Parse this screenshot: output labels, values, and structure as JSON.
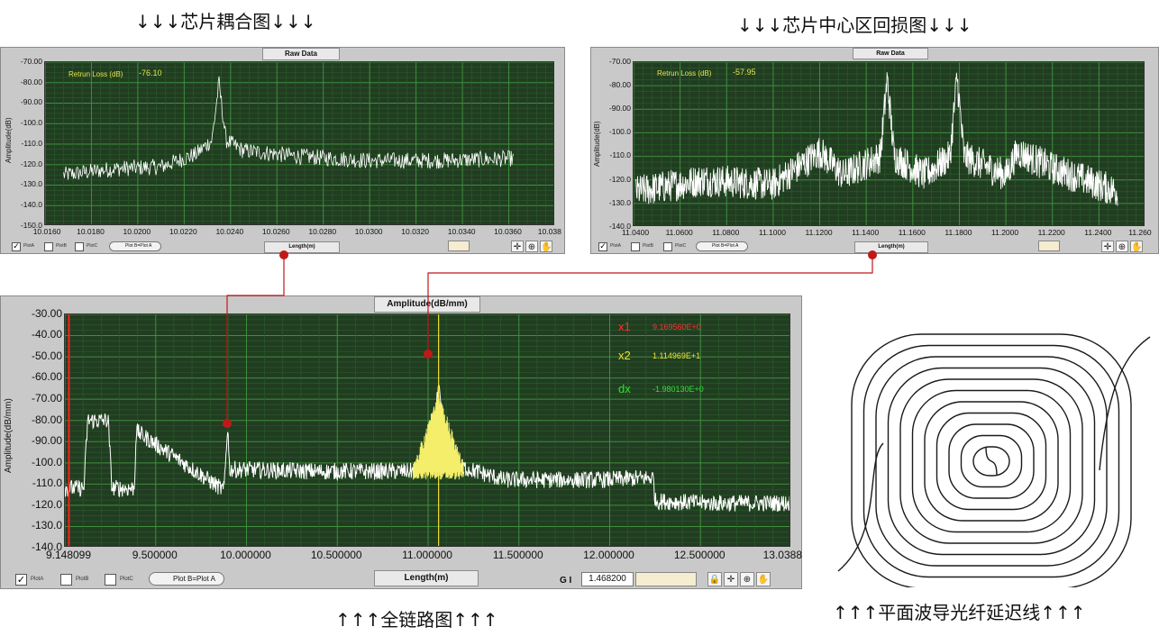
{
  "captions": {
    "chip_coupling": "↓↓↓芯片耦合图↓↓↓",
    "chip_center": "↓↓↓芯片中心区回损图↓↓↓",
    "full_link": "↑↑↑全链路图↑↑↑",
    "waveguide": "↑↑↑平面波导光纤延迟线↑↑↑"
  },
  "panels": {
    "p1": {
      "tab_top": "Raw Data",
      "tab_bottom": "Length(m)",
      "ylabel": "Amplitude(dB)",
      "annotation_label": "Retrun Loss  (dB)",
      "annotation_value": "-76.10",
      "checkboxes": [
        "PlotA",
        "PlotB",
        "PlotC"
      ],
      "plot_button": "Plot B=Plot A",
      "yticks": [
        "-70.00",
        "-80.00",
        "-90.00",
        "-100.0",
        "-110.0",
        "-120.0",
        "-130.0",
        "-140.0",
        "-150.0"
      ],
      "xticks": [
        "10.0160",
        "10.0180",
        "10.0200",
        "10.0220",
        "10.0240",
        "10.0260",
        "10.0280",
        "10.0300",
        "10.0320",
        "10.0340",
        "10.0360",
        "10.038"
      ]
    },
    "p2": {
      "tab_top": "Raw Data",
      "tab_bottom": "Length(m)",
      "ylabel": "Amplitude(dB)",
      "annotation_label": "Retrun Loss  (dB)",
      "annotation_value": "-57.95",
      "checkboxes": [
        "PlotA",
        "PlotB",
        "PlotC"
      ],
      "plot_button": "Plot B=Plot A",
      "yticks": [
        "-70.00",
        "-80.00",
        "-90.00",
        "-100.0",
        "-110.0",
        "-120.0",
        "-130.0",
        "-140.0"
      ],
      "xticks": [
        "11.0400",
        "11.0600",
        "11.0800",
        "11.1000",
        "11.1200",
        "11.1400",
        "11.1600",
        "11.1800",
        "11.2000",
        "11.2200",
        "11.2400",
        "11.260"
      ]
    },
    "p3": {
      "tab_top": "Amplitude(dB/mm)",
      "tab_bottom": "Length(m)",
      "ylabel": "Amplitude(dB/mm)",
      "checkboxes": [
        "PlotA",
        "PlotB",
        "PlotC"
      ],
      "plot_button": "Plot B=Plot A",
      "gi_label": "G I",
      "gi_value": "1.468200",
      "yticks": [
        "-30.00",
        "-40.00",
        "-50.00",
        "-60.00",
        "-70.00",
        "-80.00",
        "-90.00",
        "-100.0",
        "-110.0",
        "-120.0",
        "-130.0",
        "-140.0"
      ],
      "xticks": [
        "9.148099",
        "9.500000",
        "10.000000",
        "10.500000",
        "11.000000",
        "11.500000",
        "12.000000",
        "12.500000",
        "13.0388"
      ],
      "markers": {
        "x1_label": "x1",
        "x1_value": "9.169560E+0",
        "x2_label": "x2",
        "x2_value": "1.114969E+1",
        "dx_label": "dx",
        "dx_value": "-1.980130E+0"
      }
    }
  },
  "chart_data": [
    {
      "type": "line",
      "xlabel": "Length(m)",
      "ylabel": "Amplitude(dB)",
      "xlim": [
        10.016,
        10.038
      ],
      "ylim": [
        -150,
        -70
      ],
      "series": [
        {
          "x": [
            10.0168,
            10.019,
            10.021,
            10.0225,
            10.0232,
            10.0235,
            10.0238,
            10.0245,
            10.027,
            10.03,
            10.033,
            10.0362
          ],
          "values": [
            -125,
            -122,
            -121,
            -115,
            -108,
            -80,
            -108,
            -113,
            -116,
            -118,
            -118,
            -117
          ]
        }
      ]
    },
    {
      "type": "line",
      "xlabel": "Length(m)",
      "ylabel": "Amplitude(dB)",
      "xlim": [
        11.04,
        11.26
      ],
      "ylim": [
        -140,
        -70
      ],
      "series": [
        {
          "x": [
            11.041,
            11.07,
            11.1,
            11.12,
            11.13,
            11.146,
            11.149,
            11.152,
            11.165,
            11.176,
            11.179,
            11.182,
            11.2,
            11.205,
            11.22,
            11.248
          ],
          "values": [
            -125,
            -120,
            -122,
            -108,
            -118,
            -110,
            -77,
            -110,
            -118,
            -110,
            -76,
            -110,
            -118,
            -108,
            -115,
            -125
          ]
        }
      ]
    },
    {
      "type": "line",
      "xlabel": "Length(m)",
      "ylabel": "Amplitude(dB/mm)",
      "xlim": [
        9.148099,
        13.0388
      ],
      "ylim": [
        -140,
        -30
      ],
      "series": [
        {
          "x": [
            9.148099,
            9.25,
            9.27,
            9.38,
            9.4,
            9.52,
            9.53,
            10.0,
            10.02,
            10.03,
            10.5,
            11.0,
            11.1,
            11.14969,
            11.2,
            11.5,
            12.0,
            12.3,
            12.31,
            12.6,
            13.0388
          ],
          "values": [
            -112,
            -112,
            -80,
            -80,
            -112,
            -112,
            -85,
            -113,
            -82,
            -103,
            -104,
            -104,
            -100,
            -65,
            -100,
            -108,
            -108,
            -107,
            -118,
            -119,
            -119
          ]
        }
      ]
    }
  ]
}
